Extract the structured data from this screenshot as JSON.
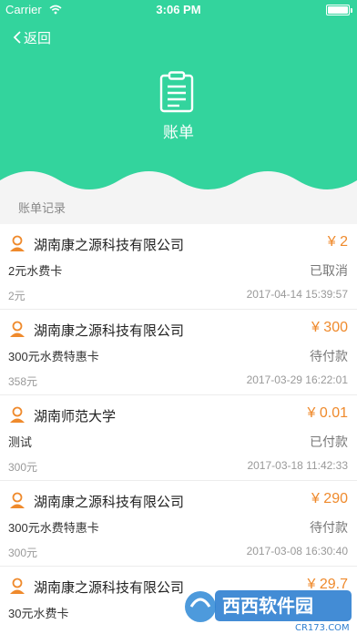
{
  "status_bar": {
    "carrier": "Carrier",
    "time": "3:06 PM"
  },
  "nav": {
    "back_label": "返回"
  },
  "header": {
    "title": "账单"
  },
  "section": {
    "label": "账单记录"
  },
  "colors": {
    "header_green": "#33d49d",
    "amount_orange": "#ef8a2c"
  },
  "records": [
    {
      "company": "湖南康之源科技有限公司",
      "amount": "¥ 2",
      "item": "2元水费卡",
      "status": "已取消",
      "price": "2元",
      "datetime": "2017-04-14 15:39:57"
    },
    {
      "company": "湖南康之源科技有限公司",
      "amount": "¥ 300",
      "item": "300元水费特惠卡",
      "status": "待付款",
      "price": "358元",
      "datetime": "2017-03-29 16:22:01"
    },
    {
      "company": "湖南师范大学",
      "amount": "¥ 0.01",
      "item": "测试",
      "status": "已付款",
      "price": "300元",
      "datetime": "2017-03-18 11:42:33"
    },
    {
      "company": "湖南康之源科技有限公司",
      "amount": "¥ 290",
      "item": "300元水费特惠卡",
      "status": "待付款",
      "price": "300元",
      "datetime": "2017-03-08 16:30:40"
    },
    {
      "company": "湖南康之源科技有限公司",
      "amount": "¥ 29.7",
      "item": "30元水费卡",
      "status": "",
      "price": "",
      "datetime": ""
    }
  ],
  "watermark": {
    "brand": "西西软件园",
    "url": "CR173.COM"
  }
}
